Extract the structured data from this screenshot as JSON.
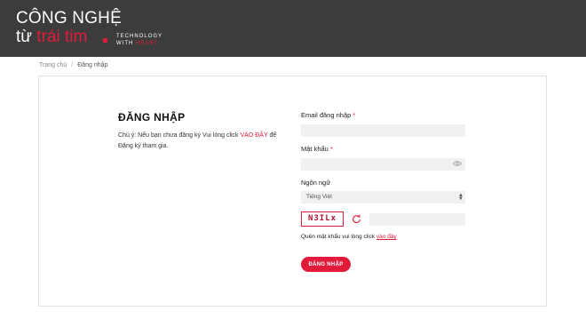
{
  "header": {
    "logo_line1": "CÔNG NGHỆ",
    "logo_line2_prefix": "từ ",
    "logo_line2_accent": "trái tim",
    "tagline_1": "TECHNOLOGY",
    "tagline_2_prefix": "WITH ",
    "tagline_2_accent": "HEART"
  },
  "breadcrumb": {
    "home": "Trang chủ",
    "separator": "/",
    "current": "Đăng nhập"
  },
  "login": {
    "title": "ĐĂNG NHẬP",
    "note_prefix": "Chú ý: Nếu bạn chưa đăng ký Vui lòng click ",
    "note_link": "VÀO ĐÂY",
    "note_suffix": " để Đăng ký tham gia.",
    "email_label": "Email đăng nhập",
    "email_value": "",
    "password_label": "Mật khẩu",
    "password_value": "",
    "required_mark": "*",
    "language_label": "Ngôn ngữ",
    "language_selected": "Tiếng Việt",
    "captcha_text": "N3ILx",
    "captcha_value": "",
    "forgot_prefix": "Quên mật khẩu vui lòng click ",
    "forgot_link": "vào đây",
    "submit_label": "ĐĂNG NHẬP"
  },
  "colors": {
    "accent": "#e31b3b",
    "header_bg": "#3c3c3c",
    "field_bg": "#f1f1f1"
  },
  "icons": {
    "password_toggle": "eye-icon",
    "captcha_refresh": "refresh-icon",
    "select_arrow": "chevron-updown-icon"
  }
}
